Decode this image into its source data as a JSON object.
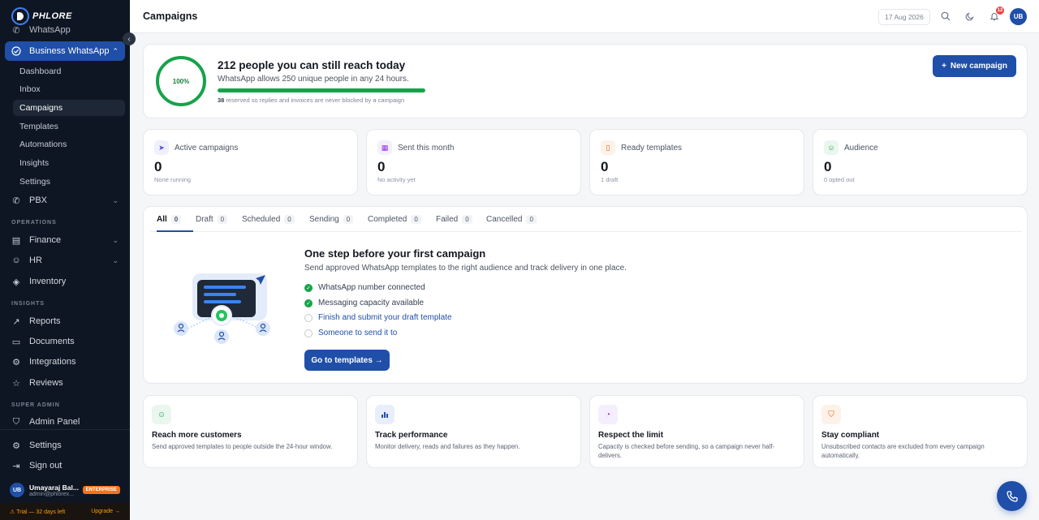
{
  "brand": {
    "name": "PHLORE",
    "accent": "#1f4fa8"
  },
  "sidebar": {
    "items_top": [
      {
        "label": "WhatsApp",
        "icon": "whatsapp-icon"
      },
      {
        "label": "Business WhatsApp",
        "icon": "check-circle-icon",
        "active": true
      }
    ],
    "sub_items": [
      {
        "label": "Dashboard"
      },
      {
        "label": "Inbox"
      },
      {
        "label": "Campaigns",
        "active": true
      },
      {
        "label": "Templates"
      },
      {
        "label": "Automations"
      },
      {
        "label": "Insights"
      },
      {
        "label": "Settings"
      }
    ],
    "pbx": "PBX",
    "section_operations": "OPERATIONS",
    "finance": "Finance",
    "hr": "HR",
    "inventory": "Inventory",
    "section_insights": "INSIGHTS",
    "reports": "Reports",
    "documents": "Documents",
    "integrations": "Integrations",
    "reviews": "Reviews",
    "section_super_admin": "SUPER ADMIN",
    "admin_panel": "Admin Panel",
    "settings": "Settings",
    "sign_out": "Sign out",
    "user": {
      "initials": "UB",
      "name": "Umayaraj Bal...",
      "email": "admin@phlorex...",
      "badge": "ENTERPRISE"
    },
    "trial": {
      "text": "⚠ Trial — 32 days left",
      "upgrade": "Upgrade →"
    }
  },
  "header": {
    "title": "Campaigns",
    "date": "17 Aug 2026",
    "notifications": "12",
    "avatar": "UB"
  },
  "capacity": {
    "percent_label": "100%",
    "percent": 100,
    "title": "212 people you can still reach today",
    "subtitle": "WhatsApp allows 250 unique people in any 24 hours.",
    "reserved_count": "38",
    "reserved_note": "reserved so replies and invoices are never blocked by a campaign",
    "new_campaign": "New campaign"
  },
  "stats": [
    {
      "label": "Active campaigns",
      "value": "0",
      "sub": "None running",
      "icon": "send-icon",
      "color": "#4f46e5",
      "bg": "#eef0fd"
    },
    {
      "label": "Sent this month",
      "value": "0",
      "sub": "No activity yet",
      "icon": "calendar-icon",
      "color": "#9333ea",
      "bg": "#f5eefd"
    },
    {
      "label": "Ready templates",
      "value": "0",
      "sub": "1 draft",
      "icon": "bookmark-icon",
      "color": "#ea580c",
      "bg": "#fdf1e8"
    },
    {
      "label": "Audience",
      "value": "0",
      "sub": "0 opted out",
      "icon": "user-icon",
      "color": "#16a34a",
      "bg": "#e9f7ee"
    }
  ],
  "tabs": [
    {
      "label": "All",
      "count": "0"
    },
    {
      "label": "Draft",
      "count": "0"
    },
    {
      "label": "Scheduled",
      "count": "0"
    },
    {
      "label": "Sending",
      "count": "0"
    },
    {
      "label": "Completed",
      "count": "0"
    },
    {
      "label": "Failed",
      "count": "0"
    },
    {
      "label": "Cancelled",
      "count": "0"
    }
  ],
  "empty_state": {
    "title": "One step before your first campaign",
    "subtitle": "Send approved WhatsApp templates to the right audience and track delivery in one place.",
    "checklist": [
      {
        "label": "WhatsApp number connected",
        "done": true
      },
      {
        "label": "Messaging capacity available",
        "done": true
      },
      {
        "label": "Finish and submit your draft template",
        "done": false
      },
      {
        "label": "Someone to send it to",
        "done": false
      }
    ],
    "button": "Go to templates →"
  },
  "tips": [
    {
      "title": "Reach more customers",
      "text": "Send approved templates to people outside the 24-hour window.",
      "icon": "users-icon",
      "color": "#16a34a",
      "bg": "#e9f7ee"
    },
    {
      "title": "Track performance",
      "text": "Monitor delivery, reads and failures as they happen.",
      "icon": "bar-chart-icon",
      "color": "#1f4fa8",
      "bg": "#e8eefb"
    },
    {
      "title": "Respect the limit",
      "text": "Capacity is checked before sending, so a campaign never half-delivers.",
      "icon": "gauge-icon",
      "color": "#9333ea",
      "bg": "#f5eefd"
    },
    {
      "title": "Stay compliant",
      "text": "Unsubscribed contacts are excluded from every campaign automatically.",
      "icon": "shield-icon",
      "color": "#ea580c",
      "bg": "#fdf1e8"
    }
  ]
}
